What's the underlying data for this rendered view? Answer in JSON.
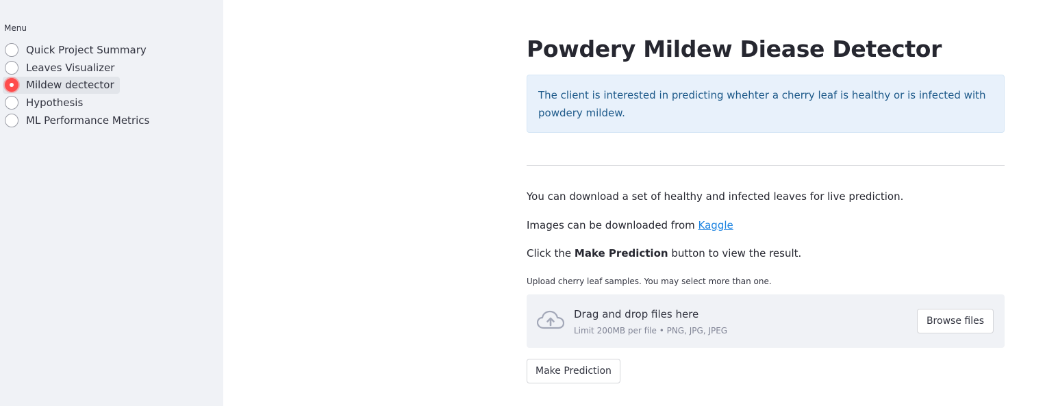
{
  "sidebar": {
    "menu_label": "Menu",
    "items": [
      {
        "label": "Quick Project Summary",
        "selected": false
      },
      {
        "label": "Leaves Visualizer",
        "selected": false
      },
      {
        "label": "Mildew dectector",
        "selected": true
      },
      {
        "label": "Hypothesis",
        "selected": false
      },
      {
        "label": "ML Performance Metrics",
        "selected": false
      }
    ]
  },
  "main": {
    "title": "Powdery Mildew Diease Detector",
    "info_text": "The client is interested in predicting whehter a cherry leaf is healthy or is infected with powdery mildew.",
    "download_text": "You can download a set of healthy and infected leaves for live prediction.",
    "images_text": "Images can be downloaded from ",
    "kaggle_link": "Kaggle",
    "click_prefix": "Click the ",
    "click_bold": "Make Prediction",
    "click_suffix": " button to view the result.",
    "uploader": {
      "label": "Upload cherry leaf samples. You may select more than one.",
      "drop_title": "Drag and drop files here",
      "drop_limit": "Limit 200MB per file • PNG, JPG, JPEG",
      "browse_label": "Browse files",
      "icon": "cloud-upload-icon"
    },
    "predict_button": "Make Prediction"
  },
  "colors": {
    "accent": "#ff4b4b",
    "sidebar_bg": "#f0f2f6",
    "info_bg": "#e8f1fb",
    "info_text": "#1e5a8a",
    "link": "#1c83e1"
  }
}
